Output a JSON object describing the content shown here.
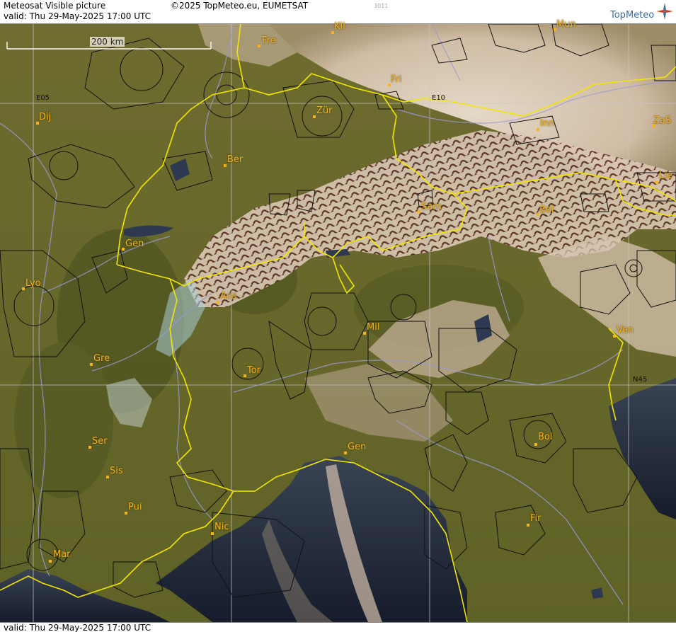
{
  "header": {
    "product": "Meteosat Visible picture",
    "valid": "valid:  Thu  29-May-2025  17:00 UTC",
    "copyright": "©2025 TopMeteo.eu, EUMETSAT",
    "code": "3011",
    "brand": "TopMeteo"
  },
  "footer": {
    "valid": "valid:  Thu  29-May-2025  17:00 UTC"
  },
  "scale": {
    "label": "200 km"
  },
  "grid_labels": {
    "e05": "E05",
    "e10": "E10",
    "n45": "N45"
  },
  "cities": [
    {
      "id": "kli",
      "label": "Kli"
    },
    {
      "id": "mun",
      "label": "Mun"
    },
    {
      "id": "fre",
      "label": "Fre"
    },
    {
      "id": "fri",
      "label": "Fri"
    },
    {
      "id": "dij",
      "label": "Dij"
    },
    {
      "id": "zur",
      "label": "Zür"
    },
    {
      "id": "inn",
      "label": "Inn"
    },
    {
      "id": "zas",
      "label": "ZaS"
    },
    {
      "id": "ber",
      "label": "Ber"
    },
    {
      "id": "lie",
      "label": "Lie"
    },
    {
      "id": "sam",
      "label": "Sam"
    },
    {
      "id": "bol1",
      "label": "Bol"
    },
    {
      "id": "gen1",
      "label": "Gen"
    },
    {
      "id": "lyo",
      "label": "Lyo"
    },
    {
      "id": "aos",
      "label": "Aos"
    },
    {
      "id": "mil",
      "label": "Mil"
    },
    {
      "id": "ven",
      "label": "Ven"
    },
    {
      "id": "gre",
      "label": "Gre"
    },
    {
      "id": "tor",
      "label": "Tor"
    },
    {
      "id": "ser",
      "label": "Ser"
    },
    {
      "id": "gen2",
      "label": "Gen"
    },
    {
      "id": "bol2",
      "label": "Bol"
    },
    {
      "id": "sis",
      "label": "Sis"
    },
    {
      "id": "pui",
      "label": "Pui"
    },
    {
      "id": "nic",
      "label": "Nic"
    },
    {
      "id": "fir",
      "label": "Fir"
    },
    {
      "id": "mar",
      "label": "Mar"
    }
  ],
  "colors": {
    "land": "#6b6a2e",
    "sea": "#1e2738",
    "cloud": "#e6d6c6",
    "border": "#f2e600",
    "city": "#f5b21c",
    "river": "#9a9ad8",
    "airspace": "#111111",
    "grid": "#c8c8c8"
  }
}
